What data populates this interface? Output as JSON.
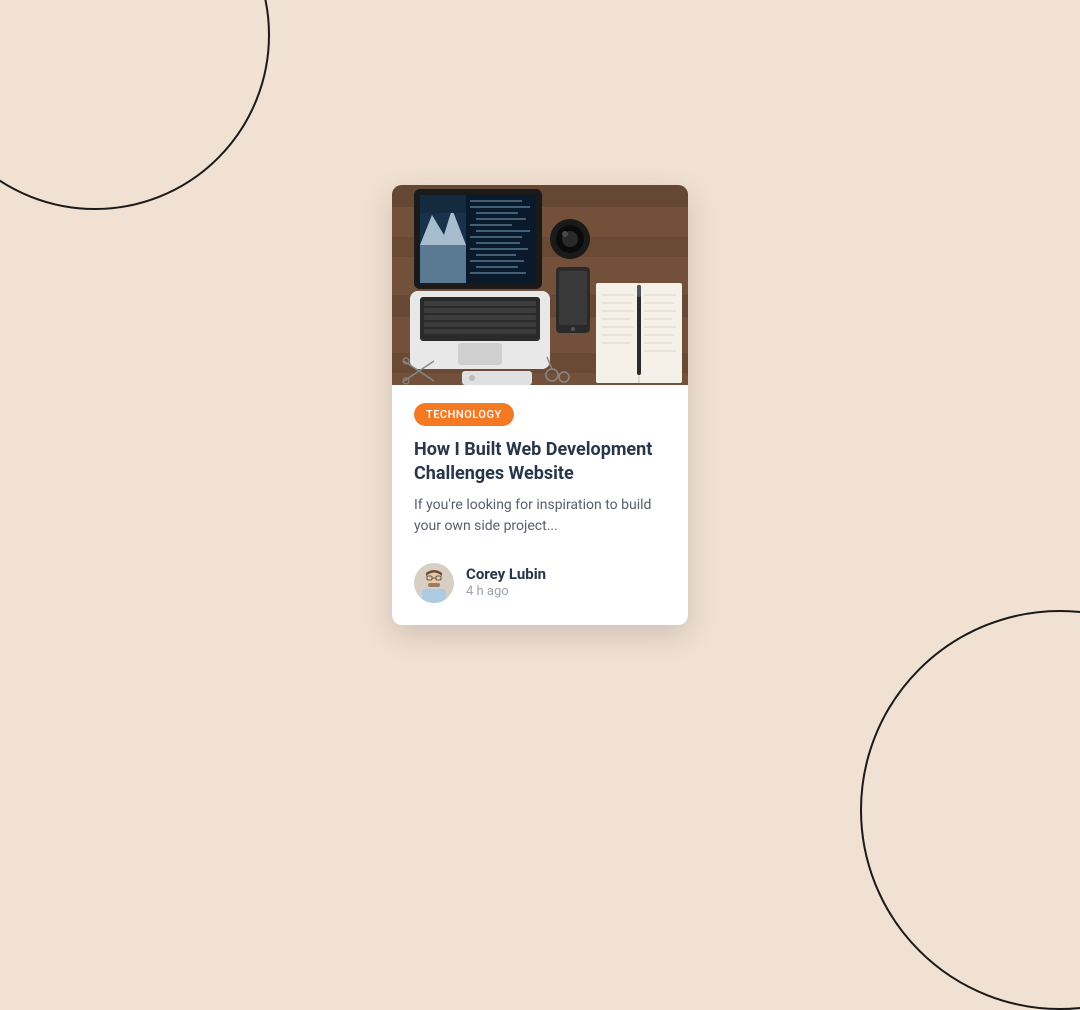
{
  "card": {
    "tag": "TECHNOLOGY",
    "title": "How I Built Web Development Challenges Website",
    "description": "If you're looking for inspiration to build your own side project...",
    "author": {
      "name": "Corey Lubin",
      "time": "4 h ago"
    }
  },
  "colors": {
    "accent": "#f37923",
    "background": "#f1e1d2",
    "heading": "#27364a",
    "body": "#56606c",
    "muted": "#9aa2ac"
  }
}
